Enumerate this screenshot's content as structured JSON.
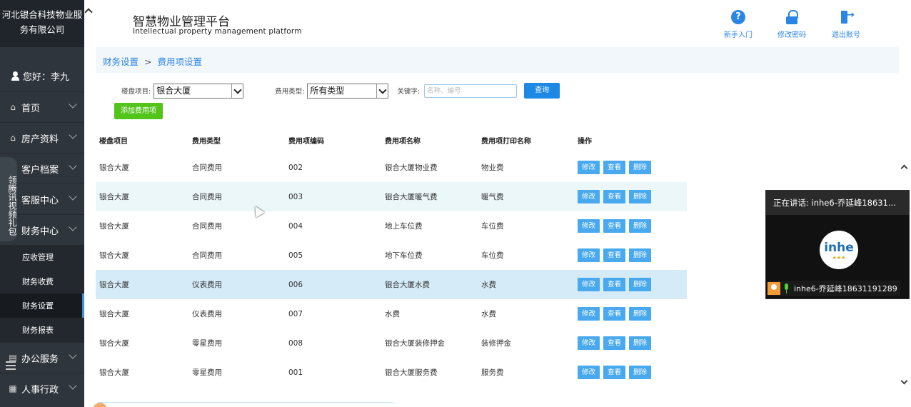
{
  "sidebar": {
    "company_line1": "河北银合科技物业服",
    "company_line2": "务有限公司",
    "greeting": "您好：李九",
    "items": [
      {
        "label": "首页",
        "icon": "⌂"
      },
      {
        "label": "房产资料",
        "icon": "⌂"
      },
      {
        "label": "客户档案",
        "icon": ""
      },
      {
        "label": "客服中心",
        "icon": ""
      },
      {
        "label": "财务中心",
        "icon": ""
      }
    ],
    "sub_items": [
      {
        "label": "应收管理"
      },
      {
        "label": "财务收费"
      },
      {
        "label": "财务设置"
      },
      {
        "label": "财务报表"
      }
    ],
    "bottom_items": [
      {
        "label": "办公服务",
        "icon": "▤"
      },
      {
        "label": "人事行政",
        "icon": "▦"
      }
    ],
    "ad_tab": "领腾讯视频礼包"
  },
  "header": {
    "title": "智慧物业管理平台",
    "subtitle": "Intellectual property management platform",
    "help_label": "新手入门",
    "password_label": "修改密码",
    "logout_label": "退出账号",
    "help_glyph": "?"
  },
  "breadcrumb": {
    "parent": "财务设置",
    "separator": ">",
    "current": "费用项设置"
  },
  "filters": {
    "property_label": "楼盘项目:",
    "property_value": "银合大厦",
    "fee_type_label": "费用类型:",
    "fee_type_value": "所有类型",
    "keyword_label": "关键字:",
    "keyword_placeholder": "名称、编号",
    "query_button": "查询",
    "add_button": "添加费用项"
  },
  "table": {
    "headers": [
      "楼盘项目",
      "费用类型",
      "费用项编码",
      "费用项名称",
      "费用项打印名称",
      "操作"
    ],
    "actions": {
      "edit": "修改",
      "view": "查看",
      "delete": "删除"
    },
    "rows": [
      {
        "project": "银合大厦",
        "type": "合同费用",
        "code": "002",
        "name": "银合大厦物业费",
        "print_name": "物业费"
      },
      {
        "project": "银合大厦",
        "type": "合同费用",
        "code": "003",
        "name": "银合大厦暖气费",
        "print_name": "暖气费"
      },
      {
        "project": "银合大厦",
        "type": "合同费用",
        "code": "004",
        "name": "地上车位费",
        "print_name": "车位费"
      },
      {
        "project": "银合大厦",
        "type": "合同费用",
        "code": "005",
        "name": "地下车位费",
        "print_name": "车位费"
      },
      {
        "project": "银合大厦",
        "type": "仪表费用",
        "code": "006",
        "name": "银合大厦水费",
        "print_name": "水费"
      },
      {
        "project": "银合大厦",
        "type": "仪表费用",
        "code": "007",
        "name": "水费",
        "print_name": "水费"
      },
      {
        "project": "银合大厦",
        "type": "零星费用",
        "code": "008",
        "name": "银合大厦装修押金",
        "print_name": "装修押金"
      },
      {
        "project": "银合大厦",
        "type": "零星费用",
        "code": "001",
        "name": "银合大厦服务费",
        "print_name": "服务费"
      }
    ]
  },
  "call_popup": {
    "header": "正在讲话: inhe6-乔延峰18631...",
    "logo_text": "inhe",
    "logo_stars": "★★★",
    "caller": "inhe6-乔延峰18631191289"
  },
  "colors": {
    "sidebar_bg": "#2f353c",
    "accent": "#2b85e4",
    "action_button": "#49a9ee",
    "add_button": "#52c41a"
  }
}
